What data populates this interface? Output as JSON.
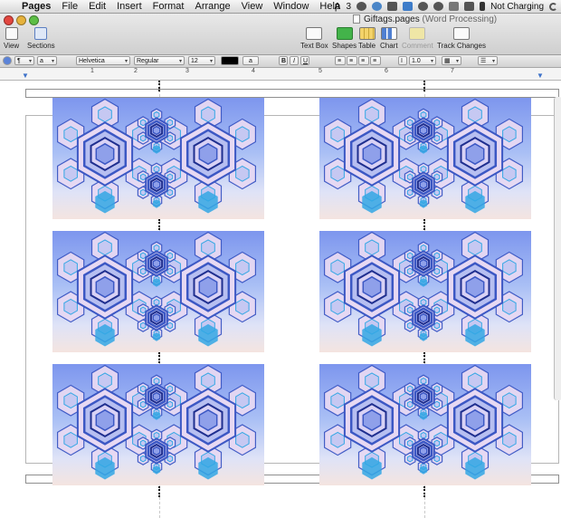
{
  "menubar": {
    "app": "Pages",
    "items": [
      "File",
      "Edit",
      "Insert",
      "Format",
      "Arrange",
      "View",
      "Window",
      "Help"
    ],
    "status": {
      "badge": "3",
      "battery": "Not Charging"
    }
  },
  "window": {
    "title": "Giftags.pages",
    "subtitle": "(Word Processing)"
  },
  "toolbar": {
    "view": "View",
    "sections": "Sections",
    "text_box": "Text Box",
    "shapes": "Shapes",
    "table": "Table",
    "chart": "Chart",
    "comment": "Comment",
    "track_changes": "Track Changes"
  },
  "formatbar": {
    "font": "Helvetica",
    "style": "Regular",
    "size": "12",
    "bold": "B",
    "italic": "I",
    "underline": "U",
    "line_spacing": "1.0",
    "text_color": "#000000"
  },
  "ruler": {
    "numbers": [
      "1",
      "2",
      "3",
      "4",
      "5",
      "6",
      "7"
    ]
  },
  "document": {
    "tag_colors": {
      "sky_top": "#7d96ee",
      "sky_bottom": "#f4e4e0",
      "crystal": "#e7d9f3",
      "crystal_edge": "#3c58c4",
      "accent": "#32a7e4"
    }
  }
}
